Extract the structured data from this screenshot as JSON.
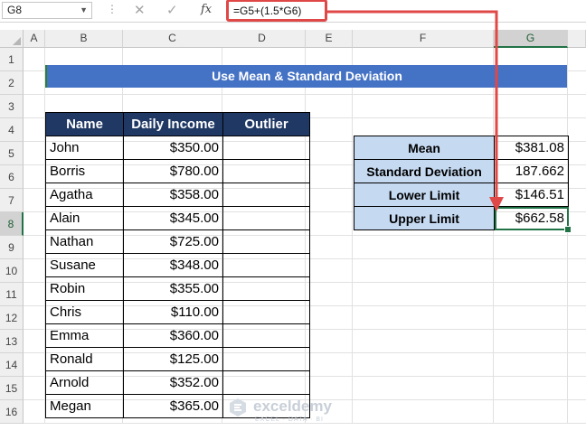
{
  "formula_bar": {
    "name_box": "G8",
    "cancel_icon": "✕",
    "enter_icon": "✓",
    "fx_label": "fx",
    "formula": "=G5+(1.5*G6)"
  },
  "columns": [
    "A",
    "B",
    "C",
    "D",
    "E",
    "F",
    "G"
  ],
  "rows": [
    "1",
    "2",
    "3",
    "4",
    "5",
    "6",
    "7",
    "8",
    "9",
    "10",
    "11",
    "12",
    "13",
    "14",
    "15",
    "16"
  ],
  "selected": {
    "column": "G",
    "row": "8"
  },
  "title": "Use Mean & Standard Deviation",
  "left_table": {
    "headers": [
      "Name",
      "Daily Income",
      "Outlier"
    ],
    "rows": [
      {
        "name": "John",
        "income": "$350.00",
        "outlier": ""
      },
      {
        "name": "Borris",
        "income": "$780.00",
        "outlier": ""
      },
      {
        "name": "Agatha",
        "income": "$358.00",
        "outlier": ""
      },
      {
        "name": "Alain",
        "income": "$345.00",
        "outlier": ""
      },
      {
        "name": "Nathan",
        "income": "$725.00",
        "outlier": ""
      },
      {
        "name": "Susane",
        "income": "$348.00",
        "outlier": ""
      },
      {
        "name": "Robin",
        "income": "$355.00",
        "outlier": ""
      },
      {
        "name": "Chris",
        "income": "$110.00",
        "outlier": ""
      },
      {
        "name": "Emma",
        "income": "$360.00",
        "outlier": ""
      },
      {
        "name": "Ronald",
        "income": "$125.00",
        "outlier": ""
      },
      {
        "name": "Arnold",
        "income": "$352.00",
        "outlier": ""
      },
      {
        "name": "Megan",
        "income": "$365.00",
        "outlier": ""
      }
    ]
  },
  "stats_table": {
    "rows": [
      {
        "label": "Mean",
        "value": "$381.08"
      },
      {
        "label": "Standard Deviation",
        "value": "187.662"
      },
      {
        "label": "Lower Limit",
        "value": "$146.51"
      },
      {
        "label": "Upper Limit",
        "value": "$662.58"
      }
    ]
  },
  "watermark": {
    "name": "exceldemy",
    "tagline": "EXCEL · DATA · BI"
  },
  "colors": {
    "title_band": "#4472c4",
    "header_fill": "#1f3864",
    "stats_label_fill": "#c5d9f1",
    "arrow": "#e04848",
    "selection": "#217346"
  }
}
